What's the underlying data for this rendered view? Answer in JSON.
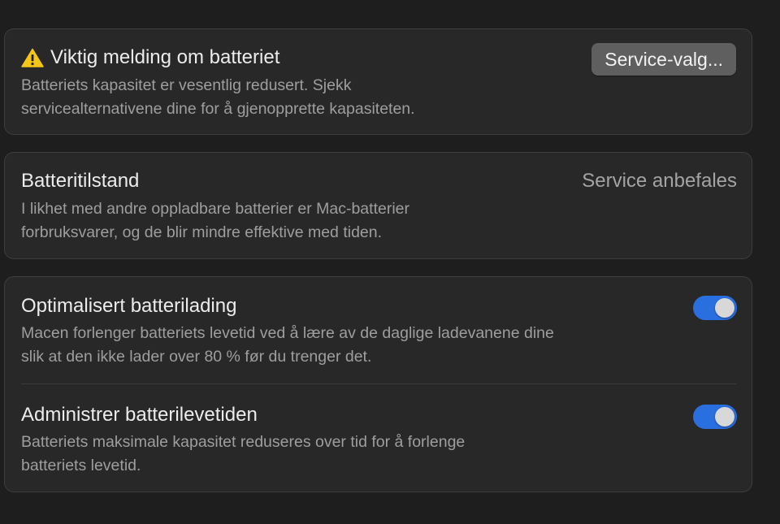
{
  "colors": {
    "background": "#1e1e1e",
    "card": "#282828",
    "toggle_on": "#2a6fe0",
    "warning": "#f5c518"
  },
  "battery_warning": {
    "icon": "warning-triangle-icon",
    "title": "Viktig melding om batteriet",
    "description_line1": "Batteriets kapasitet er vesentlig redusert. Sjekk",
    "description_line2": "servicealternativene dine for å gjenopprette kapasiteten.",
    "button_label": "Service-valg..."
  },
  "battery_health": {
    "title": "Batteritilstand",
    "status": "Service anbefales",
    "description_line1": "I likhet med andre oppladbare batterier er Mac-batterier",
    "description_line2": "forbruksvarer, og de blir mindre effektive med tiden."
  },
  "optimized_charging": {
    "title": "Optimalisert batterilading",
    "description_line1": "Macen forlenger batteriets levetid ved å lære av de daglige ladevanene dine",
    "description_line2": "slik at den ikke lader over 80 % før du trenger det.",
    "enabled": true
  },
  "manage_lifespan": {
    "title": "Administrer batterilevetiden",
    "description_line1": "Batteriets maksimale kapasitet reduseres over tid for å forlenge",
    "description_line2": "batteriets levetid.",
    "enabled": true
  }
}
